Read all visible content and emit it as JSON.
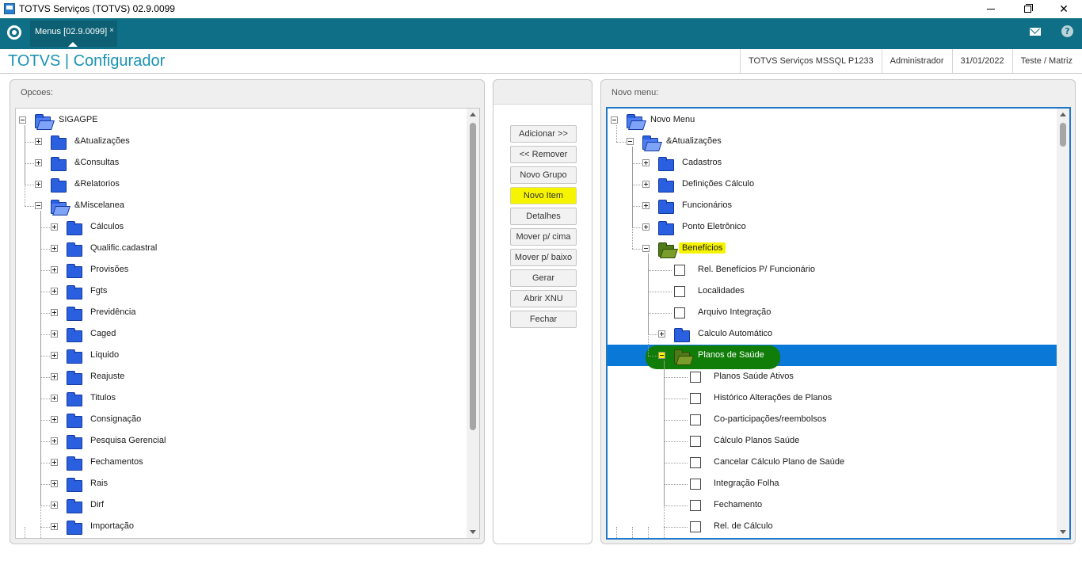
{
  "window": {
    "title": "TOTVS Serviços (TOTVS) 02.9.0099",
    "minimize_icon": "minimize-icon",
    "maximize_icon": "maximize-icon",
    "close_icon": "close-icon",
    "close_glyph": "✕"
  },
  "tabbar": {
    "logo_icon": "totvs-logo-icon",
    "tab_label": "Menus [02.9.0099]",
    "tab_close": "×",
    "mail_icon": "mail-icon",
    "help_label": "?"
  },
  "header": {
    "app_title": "TOTVS | Configurador",
    "env": "TOTVS Serviços MSSQL P1233",
    "user": "Administrador",
    "date": "31/01/2022",
    "company": "Teste / Matriz"
  },
  "left_panel": {
    "title": "Opcoes:",
    "items": [
      {
        "label": "SIGAGPE",
        "level": 0,
        "type": "folder-open",
        "expander": "minus"
      },
      {
        "label": "&Atualizações",
        "level": 1,
        "type": "folder",
        "expander": "plus"
      },
      {
        "label": "&Consultas",
        "level": 1,
        "type": "folder",
        "expander": "plus"
      },
      {
        "label": "&Relatorios",
        "level": 1,
        "type": "folder",
        "expander": "plus"
      },
      {
        "label": "&Miscelanea",
        "level": 1,
        "type": "folder-open",
        "expander": "minus"
      },
      {
        "label": "Cálculos",
        "level": 2,
        "type": "folder",
        "expander": "plus"
      },
      {
        "label": "Qualific.cadastral",
        "level": 2,
        "type": "folder",
        "expander": "plus"
      },
      {
        "label": "Provisões",
        "level": 2,
        "type": "folder",
        "expander": "plus"
      },
      {
        "label": "Fgts",
        "level": 2,
        "type": "folder",
        "expander": "plus"
      },
      {
        "label": "Previdência",
        "level": 2,
        "type": "folder",
        "expander": "plus"
      },
      {
        "label": "Caged",
        "level": 2,
        "type": "folder",
        "expander": "plus"
      },
      {
        "label": "Líquido",
        "level": 2,
        "type": "folder",
        "expander": "plus"
      },
      {
        "label": "Reajuste",
        "level": 2,
        "type": "folder",
        "expander": "plus"
      },
      {
        "label": "Titulos",
        "level": 2,
        "type": "folder",
        "expander": "plus"
      },
      {
        "label": "Consignação",
        "level": 2,
        "type": "folder",
        "expander": "plus"
      },
      {
        "label": "Pesquisa Gerencial",
        "level": 2,
        "type": "folder",
        "expander": "plus"
      },
      {
        "label": "Fechamentos",
        "level": 2,
        "type": "folder",
        "expander": "plus"
      },
      {
        "label": "Rais",
        "level": 2,
        "type": "folder",
        "expander": "plus"
      },
      {
        "label": "Dirf",
        "level": 2,
        "type": "folder",
        "expander": "plus"
      },
      {
        "label": "Importação",
        "level": 2,
        "type": "folder",
        "expander": "plus"
      }
    ]
  },
  "buttons": [
    {
      "label": "Adicionar >>",
      "name": "adicionar-button",
      "highlight": false
    },
    {
      "label": "<< Remover",
      "name": "remover-button",
      "highlight": false
    },
    {
      "label": "Novo Grupo",
      "name": "novo-grupo-button",
      "highlight": false
    },
    {
      "label": "Novo Item",
      "name": "novo-item-button",
      "highlight": true
    },
    {
      "label": "Detalhes",
      "name": "detalhes-button",
      "highlight": false
    },
    {
      "label": "Mover p/ cima",
      "name": "mover-cima-button",
      "highlight": false
    },
    {
      "label": "Mover p/ baixo",
      "name": "mover-baixo-button",
      "highlight": false
    },
    {
      "label": "Gerar",
      "name": "gerar-button",
      "highlight": false
    },
    {
      "label": "Abrir XNU",
      "name": "abrir-xnu-button",
      "highlight": false
    },
    {
      "label": "Fechar",
      "name": "fechar-button",
      "highlight": false
    }
  ],
  "right_panel": {
    "title": "Novo menu:",
    "items": [
      {
        "label": "Novo Menu",
        "level": 0,
        "type": "folder-open",
        "expander": "minus"
      },
      {
        "label": "&Atualizações",
        "level": 1,
        "type": "folder-open",
        "expander": "minus"
      },
      {
        "label": "Cadastros",
        "level": 2,
        "type": "folder",
        "expander": "plus"
      },
      {
        "label": "Definições Cálculo",
        "level": 2,
        "type": "folder",
        "expander": "plus"
      },
      {
        "label": "Funcionários",
        "level": 2,
        "type": "folder",
        "expander": "plus"
      },
      {
        "label": "Ponto Eletrônico",
        "level": 2,
        "type": "folder",
        "expander": "plus"
      },
      {
        "label": "Benefícios",
        "level": 2,
        "type": "folder-open-green",
        "expander": "minus",
        "highlight": true
      },
      {
        "label": "Rel. Benefícios P/ Funcionário",
        "level": 3,
        "type": "item"
      },
      {
        "label": "Localidades",
        "level": 3,
        "type": "item"
      },
      {
        "label": "Arquivo Integração",
        "level": 3,
        "type": "item"
      },
      {
        "label": "Calculo Automático",
        "level": 3,
        "type": "folder",
        "expander": "plus"
      },
      {
        "label": "Planos de Saúde",
        "level": 3,
        "type": "folder-open-green",
        "expander": "minus",
        "selected": true
      },
      {
        "label": "Planos Saúde Ativos",
        "level": 4,
        "type": "item"
      },
      {
        "label": "Histórico Alterações de Planos",
        "level": 4,
        "type": "item"
      },
      {
        "label": "Co-participações/reembolsos",
        "level": 4,
        "type": "item"
      },
      {
        "label": "Cálculo Planos Saúde",
        "level": 4,
        "type": "item"
      },
      {
        "label": "Cancelar Cálculo Plano de Saúde",
        "level": 4,
        "type": "item"
      },
      {
        "label": "Integração Folha",
        "level": 4,
        "type": "item"
      },
      {
        "label": "Fechamento",
        "level": 4,
        "type": "item"
      },
      {
        "label": "Rel. de Cálculo",
        "level": 4,
        "type": "item"
      }
    ]
  },
  "colors": {
    "brand": "#0f6f86",
    "title_accent": "#1b93b3",
    "selection": "#0a78d7",
    "highlight_yellow": "#f6f400",
    "highlight_green": "#0f7d07"
  }
}
